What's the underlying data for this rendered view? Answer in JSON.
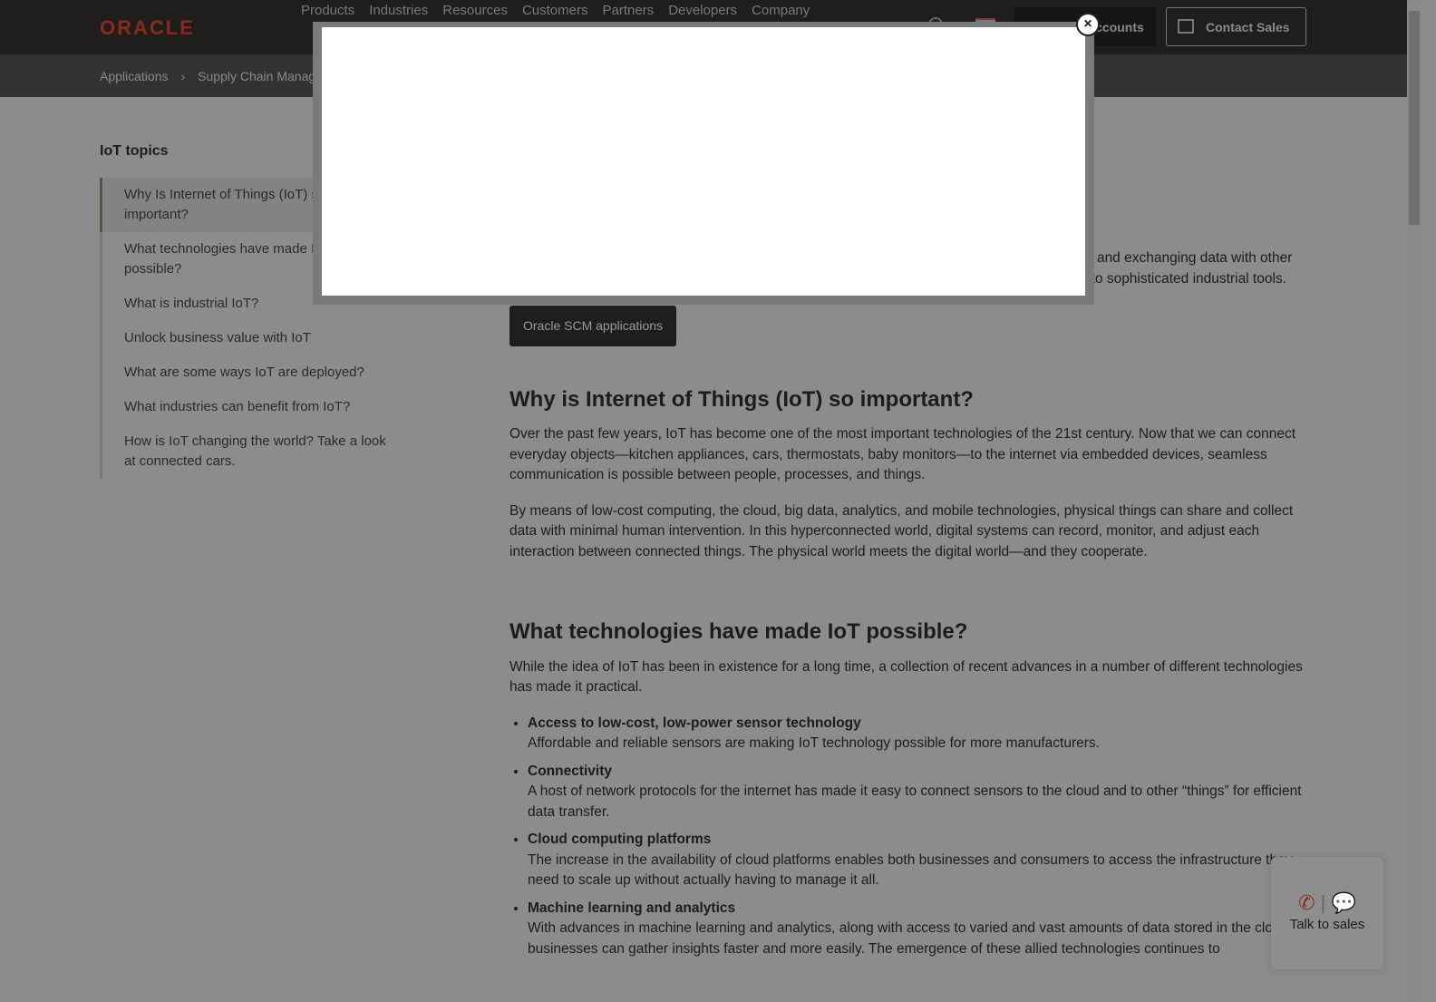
{
  "nav": {
    "logo": "ORACLE",
    "menu": [
      "Products",
      "Industries",
      "Resources",
      "Customers",
      "Partners",
      "Developers",
      "Company"
    ],
    "account": "View Accounts",
    "contact": "Contact Sales"
  },
  "breadcrumb": [
    "Applications",
    "Supply Chain Management"
  ],
  "sidebar": {
    "title": "IoT topics",
    "items": [
      "Why Is Internet of Things (IoT) so important?",
      "What technologies have made IoT possible?",
      "What is industrial IoT?",
      "Unlock business value with IoT",
      "What are some ways IoT are deployed?",
      "What industries can benefit from IoT?",
      "How is IoT changing the world? Take a look at connected cars."
    ]
  },
  "main": {
    "intro": "…are embedded with sensors, software, and other technologies for the purpose of connecting and exchanging data with other devices and systems over the internet. These devices range from ordinary household objects to sophisticated industrial tools.",
    "cta": "Oracle SCM applications",
    "h1": "Why is Internet of Things (IoT) so important?",
    "p1": "Over the past few years, IoT has become one of the most important technologies of the 21st century. Now that we can connect everyday objects—kitchen appliances, cars, thermostats, baby monitors—to the internet via embedded devices, seamless communication is possible between people, processes, and things.",
    "p2": "By means of low-cost computing, the cloud, big data, analytics, and mobile technologies, physical things can share and collect data with minimal human intervention. In this hyperconnected world, digital systems can record, monitor, and adjust each interaction between connected things. The physical world meets the digital world—and they cooperate.",
    "h2": "What technologies have made IoT possible?",
    "p3": "While the idea of IoT has been in existence for a long time, a collection of recent advances in a number of different technologies has made it practical.",
    "bullets": [
      {
        "t": "Access to low-cost, low-power sensor technology",
        "d": "Affordable and reliable sensors are making IoT technology possible for more manufacturers."
      },
      {
        "t": "Connectivity",
        "d": "A host of network protocols for the internet has made it easy to connect sensors to the cloud and to other “things” for efficient data transfer."
      },
      {
        "t": "Cloud computing platforms",
        "d": "The increase in the availability of cloud platforms enables both businesses and consumers to access the infrastructure they need to scale up without actually having to manage it all."
      },
      {
        "t": "Machine learning and analytics",
        "d": "With advances in machine learning and analytics, along with access to varied and vast amounts of data stored in the cloud, businesses can gather insights faster and more easily. The emergence of these allied technologies continues to"
      }
    ]
  },
  "modal": {
    "close": "×"
  },
  "talk": {
    "label": "Talk to sales"
  }
}
